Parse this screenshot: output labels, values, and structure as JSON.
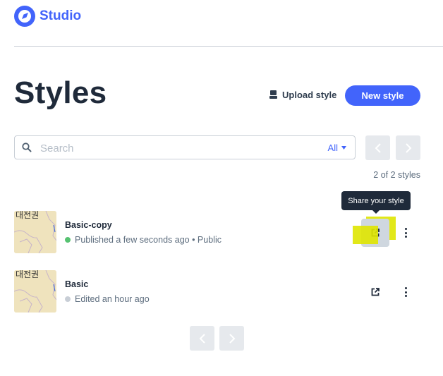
{
  "header": {
    "brand": "Studio"
  },
  "page": {
    "title": "Styles"
  },
  "actions": {
    "upload_label": "Upload style",
    "new_style_label": "New style"
  },
  "search": {
    "placeholder": "Search",
    "filter_value": "All"
  },
  "list": {
    "count_text": "2 of 2 styles"
  },
  "tooltip": {
    "text": "Share your style"
  },
  "styles": [
    {
      "name": "Basic-copy",
      "status": "Published a few seconds ago • Public",
      "status_color": "#56c271",
      "thumb_text": "대전권"
    },
    {
      "name": "Basic",
      "status": "Edited an hour ago",
      "status_color": "#c8ced6",
      "thumb_text": "대전권"
    }
  ],
  "colors": {
    "accent": "#4264fb",
    "highlight": "#dfe600"
  }
}
